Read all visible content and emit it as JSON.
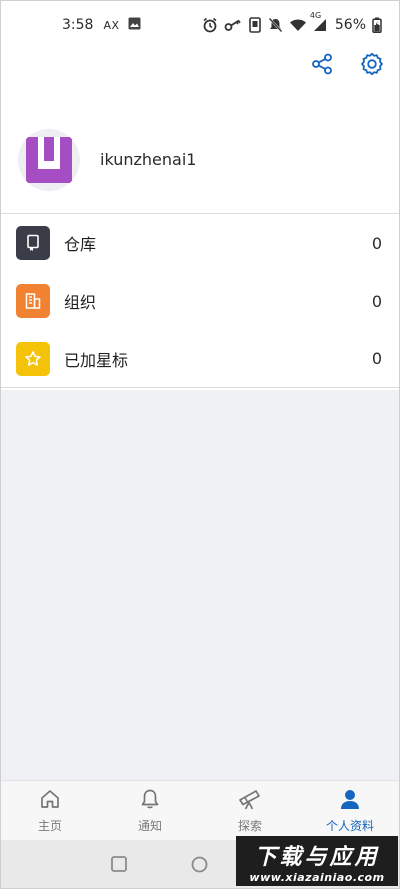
{
  "status_bar": {
    "time": "3:58",
    "carrier_tag": "AX",
    "network": "4G",
    "battery": "56%"
  },
  "actions": {
    "share_icon": "share-icon",
    "settings_icon": "gear-icon"
  },
  "profile": {
    "username": "ikunzhenai1",
    "avatar_color": "#a54ec4"
  },
  "list": [
    {
      "label": "仓库",
      "count": "0",
      "icon": "repository-icon",
      "color": "#3a3d48"
    },
    {
      "label": "组织",
      "count": "0",
      "icon": "building-icon",
      "color": "#f08232"
    },
    {
      "label": "已加星标",
      "count": "0",
      "icon": "star-icon",
      "color": "#f5c20a"
    }
  ],
  "bottom_nav": [
    {
      "label": "主页",
      "icon": "home-icon",
      "active": false
    },
    {
      "label": "通知",
      "icon": "bell-icon",
      "active": false
    },
    {
      "label": "探索",
      "icon": "telescope-icon",
      "active": false
    },
    {
      "label": "个人资料",
      "icon": "person-icon",
      "active": true
    }
  ],
  "colors": {
    "accent": "#1565c0",
    "background_gray": "#f0f1f4"
  },
  "watermark": {
    "title": "下载与应用",
    "url": "www.xiazainiao.com"
  }
}
